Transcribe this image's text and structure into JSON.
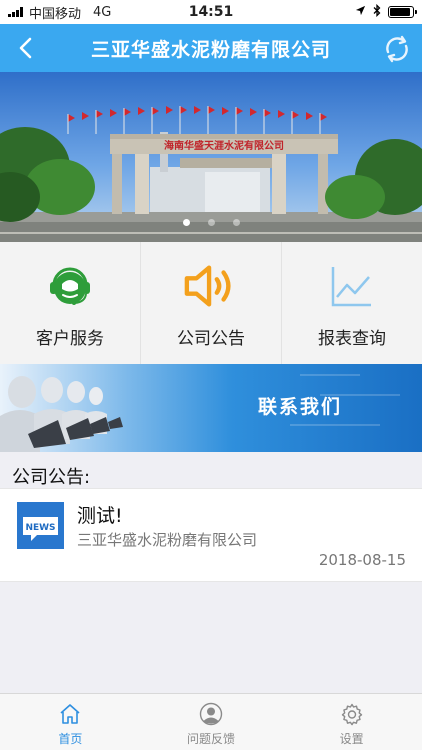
{
  "status_bar": {
    "carrier": "中国移动",
    "network": "4G",
    "time": "14:51",
    "battery_level": 0.9
  },
  "header": {
    "title": "三亚华盛水泥粉磨有限公司",
    "back_icon": "back-arrow-icon",
    "refresh_icon": "refresh-icon"
  },
  "banner": {
    "gate_sign": "海南华盛天涯水泥有限公司",
    "slide_count": 3,
    "active_slide": 1
  },
  "menu": {
    "items": [
      {
        "label": "客户服务",
        "icon": "customer-service-icon",
        "color": "#2e9d3a"
      },
      {
        "label": "公司公告",
        "icon": "speaker-icon",
        "color": "#f3a01c"
      },
      {
        "label": "报表查询",
        "icon": "chart-icon",
        "color": "#8ec7ee"
      }
    ]
  },
  "contact_banner": {
    "label": "联系我们"
  },
  "announcements": {
    "section_title": "公司公告:",
    "items": [
      {
        "thumb_text": "NEWS",
        "title": "测试!",
        "company": "三亚华盛水泥粉磨有限公司",
        "date": "2018-08-15"
      }
    ]
  },
  "tab_bar": {
    "tabs": [
      {
        "label": "首页",
        "icon": "home-icon",
        "active": true
      },
      {
        "label": "问题反馈",
        "icon": "user-icon",
        "active": false
      },
      {
        "label": "设置",
        "icon": "gear-icon",
        "active": false
      }
    ]
  },
  "colors": {
    "primary": "#3aa8f0",
    "tab_active": "#2e8fe0"
  }
}
